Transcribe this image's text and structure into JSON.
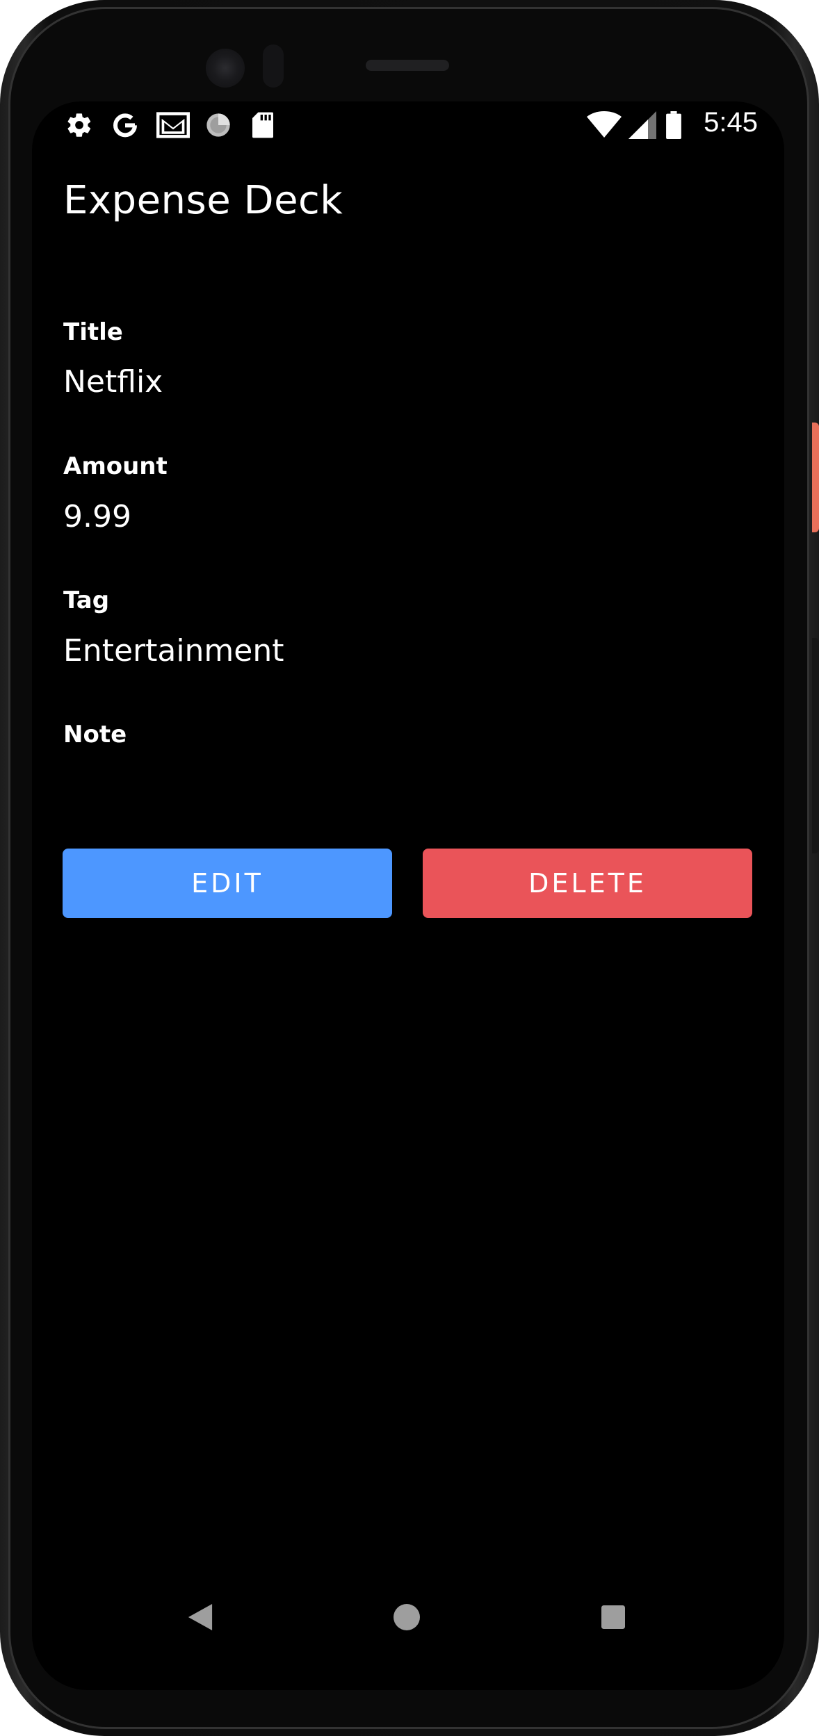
{
  "status_bar": {
    "time": "5:45",
    "left_icons": [
      "settings-icon",
      "google-icon",
      "gmail-icon",
      "sync-spinner-icon",
      "sd-card-icon"
    ],
    "right_icons": [
      "wifi-icon",
      "signal-icon",
      "battery-icon"
    ]
  },
  "app": {
    "title": "Expense Deck"
  },
  "details": {
    "title_label": "Title",
    "title_value": "Netflix",
    "amount_label": "Amount",
    "amount_value": "9.99",
    "tag_label": "Tag",
    "tag_value": "Entertainment",
    "note_label": "Note",
    "note_value": ""
  },
  "actions": {
    "edit_label": "EDIT",
    "delete_label": "DELETE"
  },
  "colors": {
    "edit_button": "#4d97ff",
    "delete_button": "#ea5459",
    "background": "#000000",
    "text": "#ffffff",
    "nav_icon": "#9e9e9e"
  },
  "nav_bar": {
    "items": [
      "back-icon",
      "home-icon",
      "recents-icon"
    ]
  }
}
